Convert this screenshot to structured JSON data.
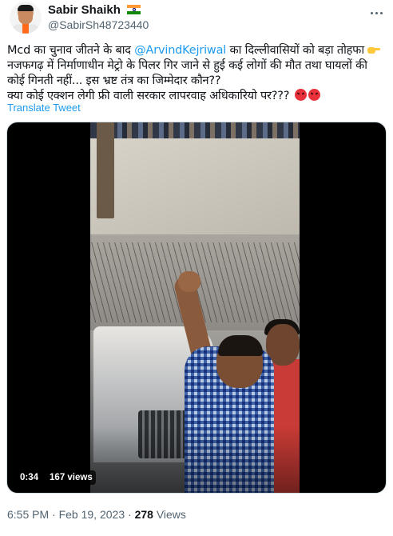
{
  "author": {
    "display_name": "Sabir Shaikh",
    "flag_icon": "india-flag-icon",
    "handle": "@SabirSh48723440"
  },
  "tweet": {
    "line1_before": "Mcd का चुनाव जीतने के बाद ",
    "mention": "@ArvindKejriwal",
    "line1_after": " का दिल्लीवासियों को बड़ा तोहफा ",
    "line2": "नजफगढ़ में निर्माणाधीन मेट्रो के पिलर गिर जाने से हुई कई लोगों की मौत तथा घायलों की कोई गिनती नहीं... इस भ्रष्ट तंत्र का जिम्मेदार कौन??",
    "line3": "क्या कोई एक्शन लेगी फ्री वाली सरकार लापरवाह अधिकारियो पर???",
    "translate_label": "Translate Tweet"
  },
  "video": {
    "duration": "0:34",
    "views_label": "167 views"
  },
  "footer": {
    "time": "6:55 PM",
    "separator": "·",
    "date": "Feb 19, 2023",
    "views_count": "278",
    "views_word": "Views"
  },
  "colors": {
    "accent": "#1d9bf0",
    "secondary_text": "#536471",
    "primary_text": "#0f1419"
  }
}
